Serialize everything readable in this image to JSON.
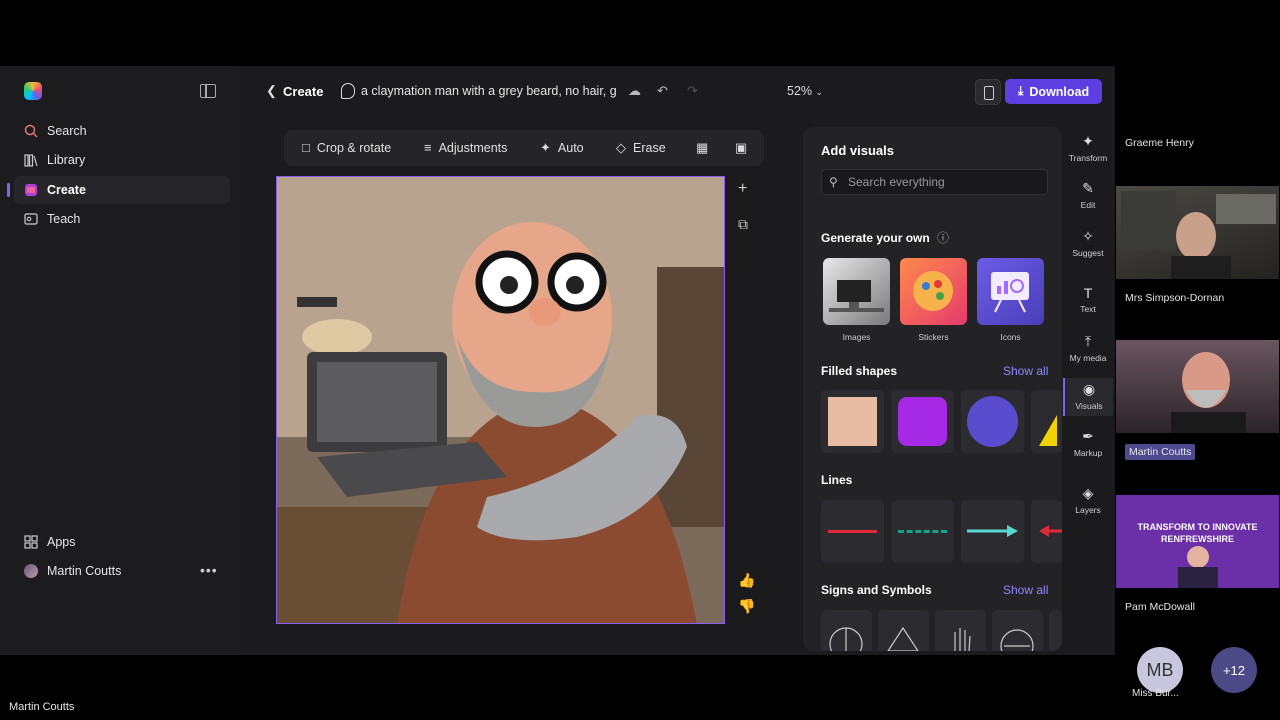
{
  "sidebar": {
    "items": [
      {
        "label": "Search",
        "icon": "search-icon"
      },
      {
        "label": "Library",
        "icon": "library-icon"
      },
      {
        "label": "Create",
        "icon": "create-icon"
      },
      {
        "label": "Teach",
        "icon": "teach-icon"
      }
    ],
    "apps_label": "Apps",
    "user_name": "Martin Coutts"
  },
  "topbar": {
    "back_label": "Create",
    "prompt_text": "a claymation man with a grey beard, no hair, glass",
    "zoom": "52%",
    "download_label": "Download"
  },
  "toolbar": {
    "crop": "Crop & rotate",
    "adjustments": "Adjustments",
    "auto": "Auto",
    "erase": "Erase"
  },
  "visuals": {
    "title": "Add visuals",
    "search_placeholder": "Search everything",
    "generate_label": "Generate your own",
    "generate_items": [
      "Images",
      "Stickers",
      "Icons"
    ],
    "filled_shapes_label": "Filled shapes",
    "lines_label": "Lines",
    "signs_label": "Signs and Symbols",
    "show_all": "Show all",
    "colors": {
      "peach": "#e8bca4",
      "purple": "#a629e6",
      "indigo": "#5b4ccf",
      "yellow": "#f0d300",
      "red": "#e0283c",
      "teal": "#12a58a",
      "cyan": "#5bd6d0"
    }
  },
  "rail": [
    "Transform",
    "Edit",
    "Suggest",
    "Text",
    "My media",
    "Visuals",
    "Markup",
    "Layers"
  ],
  "participants": {
    "names": [
      "Graeme Henry",
      "Mrs Simpson-Dornan",
      "Martin Coutts",
      "Pam McDowall"
    ],
    "banner": "TRANSFORM TO INNOVATE RENFREWSHIRE",
    "mb_initials": "MB",
    "mb_name": "Miss Bur...",
    "more": "+12"
  },
  "presenter_name": "Martin Coutts"
}
